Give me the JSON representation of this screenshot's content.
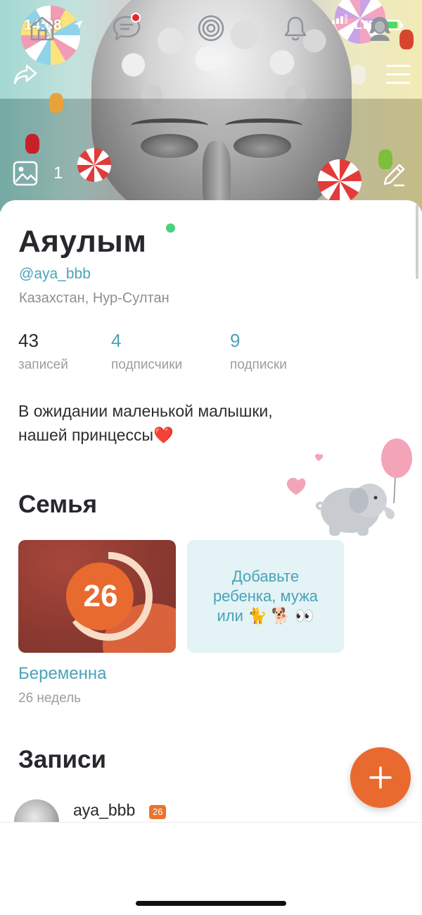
{
  "status_bar": {
    "time": "14:08",
    "network": "LTE"
  },
  "cover": {
    "photo_count": "1"
  },
  "profile": {
    "name": "Аяулым",
    "username": "@aya_bbb",
    "location": "Казахстан, Нур-Султан",
    "online": true,
    "stats": [
      {
        "value": "43",
        "label": "записей"
      },
      {
        "value": "4",
        "label": "подписчики"
      },
      {
        "value": "9",
        "label": "подписки"
      }
    ],
    "bio_line1": "В ожидании маленькой малышки,",
    "bio_line2": "нашей принцессы",
    "bio_emoji": "❤️"
  },
  "family": {
    "title": "Семья",
    "pregnancy": {
      "weeks_number": "26",
      "progress_fraction": 0.65,
      "label": "Беременна",
      "weeks_text": "26 недель"
    },
    "add_card": {
      "text_line1": "Добавьте",
      "text_line2": "ребенка, мужа",
      "text_line3": "или 🐈 🐕 👀"
    }
  },
  "posts": {
    "title": "Записи",
    "preview": {
      "author": "aya_bbb",
      "badge": "26",
      "more": "..."
    }
  },
  "tabbar": {
    "items": [
      {
        "name": "home",
        "icon": "home-icon"
      },
      {
        "name": "messages",
        "icon": "chat-icon",
        "has_badge": true
      },
      {
        "name": "feed",
        "icon": "target-icon"
      },
      {
        "name": "notifications",
        "icon": "bell-icon"
      },
      {
        "name": "profile",
        "icon": "profile-icon"
      }
    ]
  },
  "colors": {
    "accent_teal": "#4aa2b8",
    "accent_orange": "#e96a2e",
    "online_green": "#4cd07d",
    "badge_red": "#e02b2b"
  }
}
